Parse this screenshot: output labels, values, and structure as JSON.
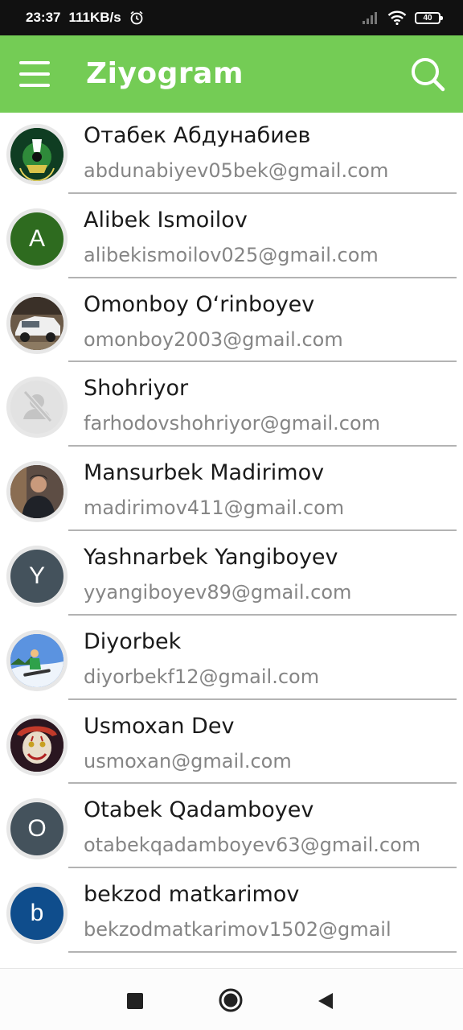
{
  "status_bar": {
    "time": "23:37",
    "network_speed": "111KB/s",
    "battery_level": "40",
    "icons": [
      "alarm-icon",
      "signal-icon",
      "wifi-icon",
      "battery-icon"
    ]
  },
  "app_bar": {
    "title": "Ziyogram",
    "menu_icon": "menu-icon",
    "search_icon": "search-icon",
    "color": "#74cc55"
  },
  "contacts": [
    {
      "name": "Отабек Абдунабиев",
      "email": "abdunabiyev05bek@gmail.com",
      "avatar": "photo-emblem"
    },
    {
      "name": "Alibek Ismoilov",
      "email": "alibekismoilov025@gmail.com",
      "avatar": "letter",
      "initial": "A",
      "color": "#2e6b1f"
    },
    {
      "name": "Omonboy O‘rinboyev",
      "email": "omonboy2003@gmail.com",
      "avatar": "photo-car"
    },
    {
      "name": "Shohriyor",
      "email": "farhodovshohriyor@gmail.com",
      "avatar": "no-photo"
    },
    {
      "name": "Mansurbek Madirimov",
      "email": "madirimov411@gmail.com",
      "avatar": "photo-person"
    },
    {
      "name": "Yashnarbek Yangiboyev",
      "email": "yyangiboyev89@gmail.com",
      "avatar": "letter",
      "initial": "Y",
      "color": "#44525c"
    },
    {
      "name": "Diyorbek",
      "email": "diyorbekf12@gmail.com",
      "avatar": "photo-snowboard"
    },
    {
      "name": "Usmoxan Dev",
      "email": "usmoxan@gmail.com",
      "avatar": "photo-clown"
    },
    {
      "name": "Otabek Qadamboyev",
      "email": "otabekqadamboyev63@gmail.com",
      "avatar": "letter",
      "initial": "O",
      "color": "#44525c"
    },
    {
      "name": "bekzod matkarimov",
      "email": "bekzodmatkarimov1502@gmail",
      "avatar": "letter",
      "initial": "b",
      "color": "#0f4d8c"
    }
  ],
  "nav_bar": {
    "icons": [
      "recents-square-icon",
      "home-circle-icon",
      "back-triangle-icon"
    ]
  }
}
